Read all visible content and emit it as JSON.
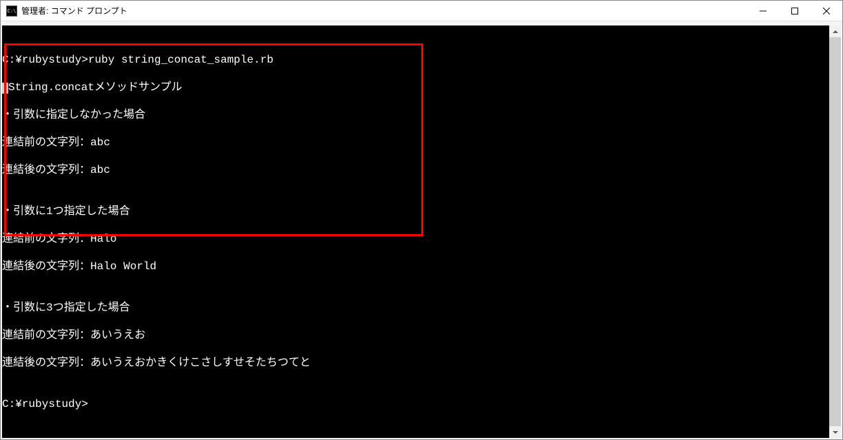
{
  "window": {
    "title": "管理者: コマンド プロンプト"
  },
  "terminal": {
    "blank0": "",
    "prompt_cmd": "C:¥rubystudy>ruby string_concat_sample.rb",
    "header": "String.concatメソッドサンプル",
    "case1_title": "・引数に指定しなかった場合",
    "case1_before": "連結前の文字列：abc",
    "case1_after": "連結後の文字列：abc",
    "blank1": "",
    "case2_title": "・引数に1つ指定した場合",
    "case2_before": "連結前の文字列：Halo",
    "case2_after": "連結後の文字列：Halo World",
    "blank2": "",
    "case3_title": "・引数に3つ指定した場合",
    "case3_before": "連結前の文字列：あいうえお",
    "case3_after": "連結後の文字列：あいうえおかきくけこさしすせそたちつてと",
    "blank3": "",
    "prompt_end": "C:¥rubystudy>"
  }
}
